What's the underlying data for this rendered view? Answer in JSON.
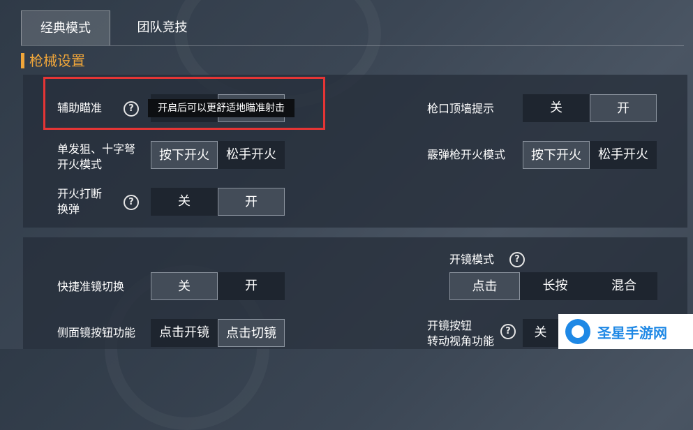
{
  "tabs": [
    {
      "label": "经典模式",
      "active": true
    },
    {
      "label": "团队竞技",
      "active": false
    }
  ],
  "section_title": "枪械设置",
  "settings": {
    "aim_assist": {
      "label": "辅助瞄准",
      "tooltip": "开启后可以更舒适地瞄准射击"
    },
    "muzzle_wall": {
      "label": "枪口顶墙提示",
      "options": [
        "关",
        "开"
      ],
      "selected": "开"
    },
    "sniper_fire": {
      "label_line1": "单发狙、十字弩",
      "label_line2": "开火模式",
      "options": [
        "按下开火",
        "松手开火"
      ],
      "selected": "按下开火"
    },
    "shotgun_fire": {
      "label": "霰弹枪开火模式",
      "options": [
        "按下开火",
        "松手开火"
      ],
      "selected": "按下开火"
    },
    "fire_interrupt": {
      "label_line1": "开火打断",
      "label_line2": "换弹",
      "options": [
        "关",
        "开"
      ],
      "selected": "开"
    },
    "quick_scope": {
      "label": "快捷准镜切换",
      "options": [
        "关",
        "开"
      ],
      "selected": "关"
    },
    "scope_mode": {
      "label": "开镜模式",
      "options": [
        "点击",
        "长按",
        "混合"
      ],
      "selected": "点击"
    },
    "side_scope": {
      "label": "侧面镜按钮功能",
      "options": [
        "点击开镜",
        "点击切镜"
      ],
      "selected": "点击切镜"
    },
    "scope_turn": {
      "label_line1": "开镜按钮",
      "label_line2": "转动视角功能",
      "partial_option": "关"
    }
  },
  "help_glyph": "?",
  "watermark": {
    "text": "圣星手游网"
  },
  "colors": {
    "accent": "#f0a63a",
    "highlight_box": "#e53535",
    "watermark": "#1e88e5"
  }
}
